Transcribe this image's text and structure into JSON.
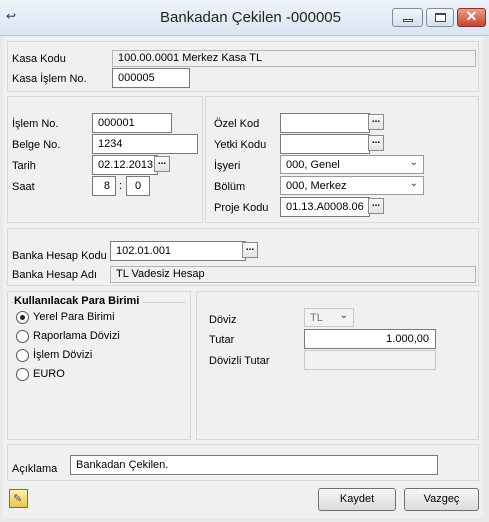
{
  "window": {
    "title": "Bankadan Çekilen -000005",
    "minimize": "–",
    "maximize": "□",
    "close": "✕"
  },
  "kasa": {
    "kod_label": "Kasa Kodu",
    "kod_value": "100.00.0001 Merkez Kasa TL",
    "islem_label": "Kasa İşlem No.",
    "islem_value": "000005"
  },
  "left": {
    "islem_no_label": "İşlem No.",
    "islem_no": "000001",
    "belge_no_label": "Belge No.",
    "belge_no": "1234",
    "tarih_label": "Tarih",
    "tarih": "02.12.2013",
    "saat_label": "Saat",
    "saat_h": "8",
    "saat_sep": ":",
    "saat_m": "0"
  },
  "right": {
    "ozel_kod_label": "Özel Kod",
    "ozel_kod": "",
    "yetki_kodu_label": "Yetki Kodu",
    "yetki_kodu": "",
    "isyeri_label": "İşyeri",
    "isyeri": "000, Genel",
    "bolum_label": "Bölüm",
    "bolum": "000, Merkez",
    "proje_kodu_label": "Proje Kodu",
    "proje_kodu": "01.13.A0008.06"
  },
  "banka": {
    "hesap_kodu_label": "Banka Hesap Kodu",
    "hesap_kodu": "102.01.001",
    "hesap_adi_label": "Banka Hesap Adı",
    "hesap_adi": "TL Vadesiz Hesap"
  },
  "para_birimi": {
    "title": "Kullanılacak Para Birimi",
    "options": [
      {
        "label": "Yerel Para Birimi",
        "checked": true
      },
      {
        "label": "Raporlama Dövizi",
        "checked": false
      },
      {
        "label": "İşlem Dövizi",
        "checked": false
      },
      {
        "label": "EURO",
        "checked": false
      }
    ]
  },
  "doviz": {
    "doviz_label": "Döviz",
    "doviz_value": "TL",
    "tutar_label": "Tutar",
    "tutar_value": "1.000,00",
    "dovizli_tutar_label": "Dövizli Tutar",
    "dovizli_tutar_value": ""
  },
  "aciklama": {
    "label": "Açıklama",
    "value": "Bankadan Çekilen."
  },
  "buttons": {
    "ellipsis": "...",
    "save": "Kaydet",
    "cancel": "Vazgeç"
  },
  "icons": {
    "app": "↩",
    "dropdown": "⌄",
    "tool": "✎"
  }
}
